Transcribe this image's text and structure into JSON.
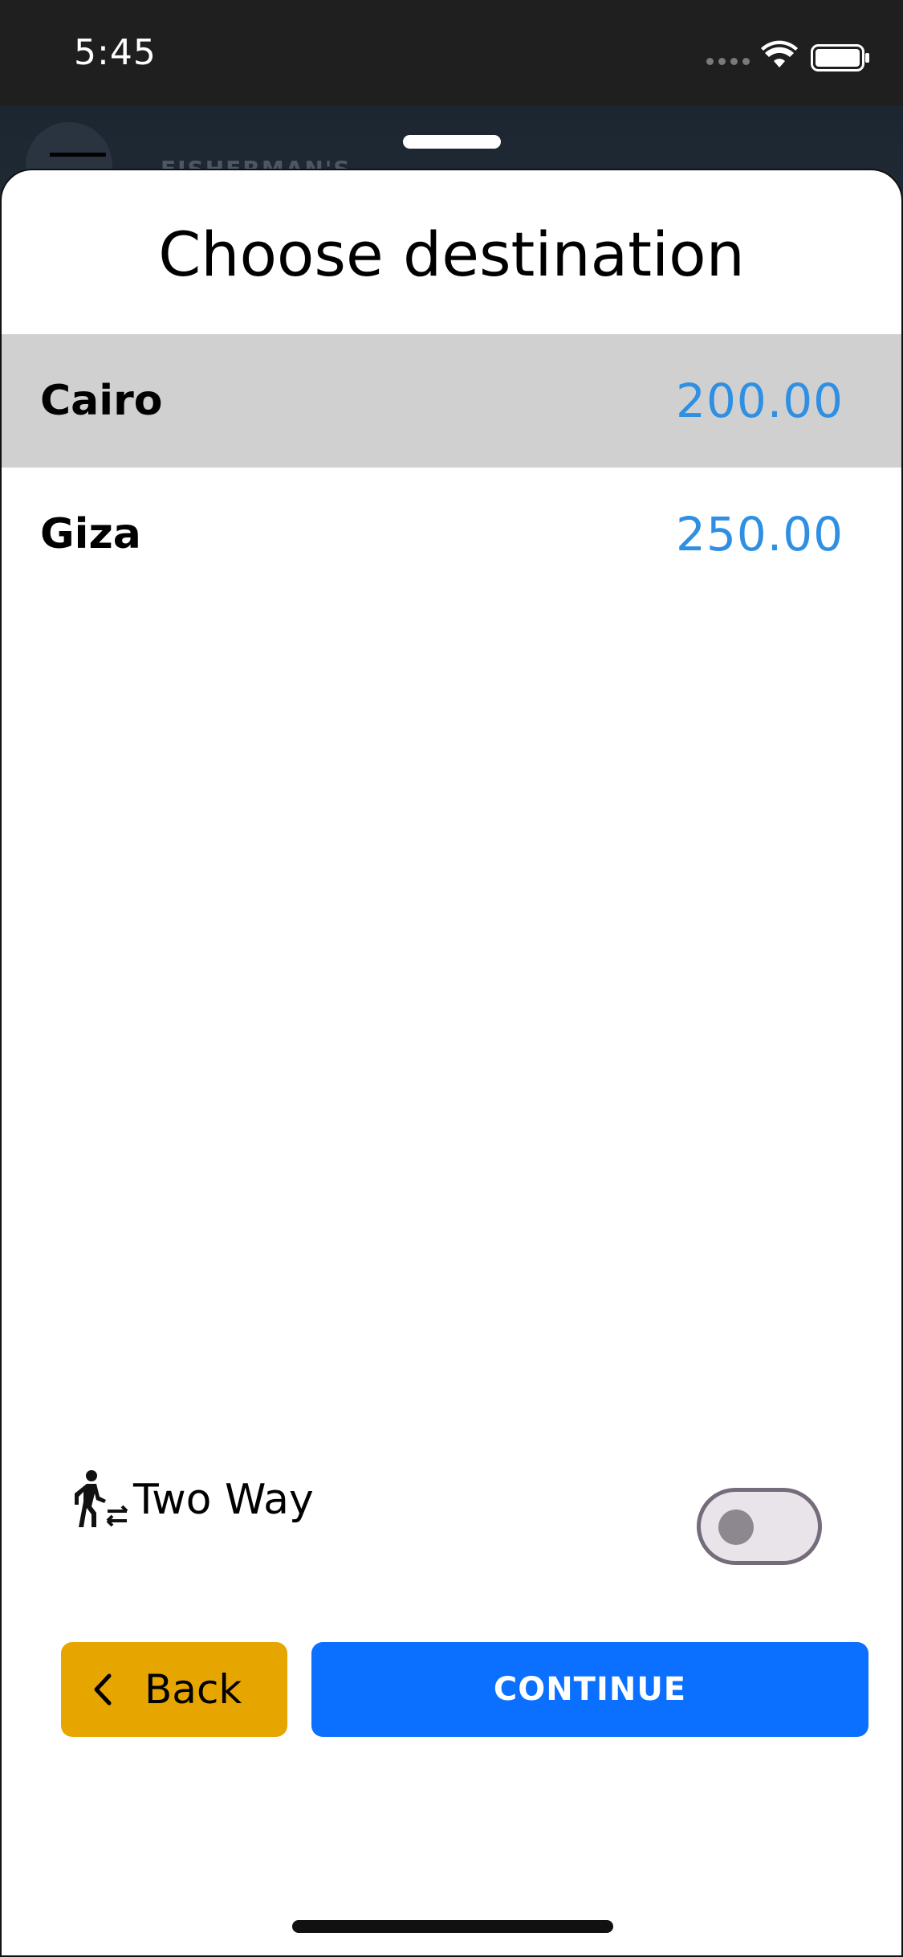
{
  "status_bar": {
    "time": "5:45",
    "icons": [
      "signal-dots-icon",
      "wifi-icon",
      "battery-icon"
    ]
  },
  "map": {
    "label": "FISHERMAN'S"
  },
  "sheet": {
    "title": "Choose destination",
    "destinations": [
      {
        "name": "Cairo",
        "price": "200.00",
        "selected": true
      },
      {
        "name": "Giza",
        "price": "250.00",
        "selected": false
      }
    ],
    "two_way": {
      "icon": "walking-transfer-icon",
      "label": "Two Way",
      "enabled": false
    },
    "back_button": {
      "icon": "chevron-left-icon",
      "label": "Back"
    },
    "continue_button": {
      "label": "CONTINUE"
    }
  },
  "colors": {
    "price": "#2e8fe3",
    "selected_row": "#d0d0d0",
    "back_button": "#e7a500",
    "continue_button": "#0b70ff"
  }
}
